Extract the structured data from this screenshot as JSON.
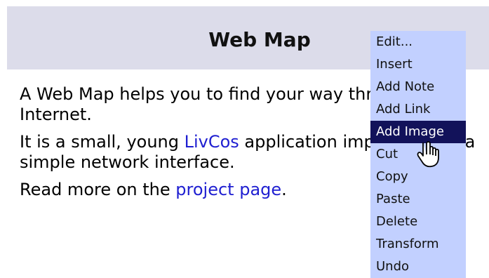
{
  "header": {
    "title": "Web Map"
  },
  "content": {
    "paragraph1": "A Web Map helps you to find your way through the Internet.",
    "paragraph2_prefix": "It is a small, young ",
    "paragraph2_link": "LivCos",
    "paragraph2_suffix": " application implementing a simple network interface.",
    "paragraph3_prefix": "Read more on the ",
    "paragraph3_link": "project page",
    "paragraph3_suffix": "."
  },
  "context_menu": {
    "items": [
      "Edit...",
      "Insert",
      "Add Note",
      "Add Link",
      "Add Image",
      "Cut",
      "Copy",
      "Paste",
      "Delete",
      "Transform",
      "Undo"
    ],
    "active_item": "Add Image"
  },
  "colors": {
    "header_background": "#dcdcea",
    "link": "#1f1fd1",
    "menu_background": "#c2d0ff",
    "menu_highlight": "#12125a"
  },
  "icons": {
    "cursor": "hand-pointer-icon"
  }
}
